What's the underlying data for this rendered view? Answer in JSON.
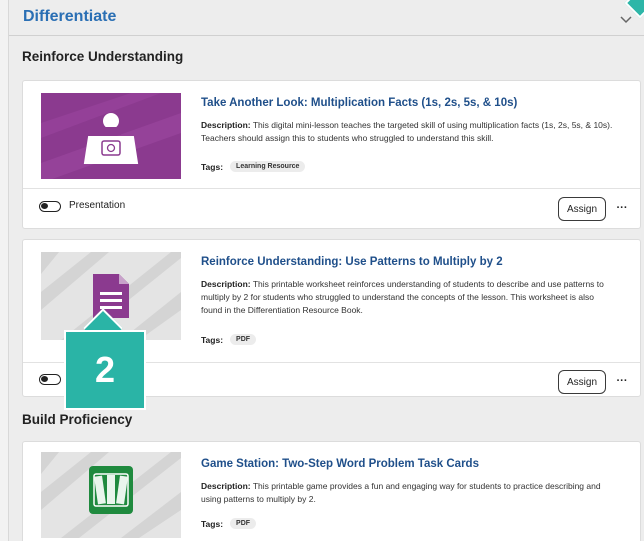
{
  "header": {
    "title": "Differentiate"
  },
  "sections": {
    "reinforce": {
      "title": "Reinforce Understanding"
    },
    "proficiency": {
      "title": "Build Proficiency"
    }
  },
  "cards": [
    {
      "title": "Take Another Look: Multiplication Facts (1s, 2s, 5s, & 10s)",
      "desc_label": "Description:",
      "description": "This digital mini-lesson teaches the targeted skill of using multiplication facts (1s, 2s, 5s, & 10s). Teachers should assign this to students who struggled to understand this skill.",
      "tags_label": "Tags:",
      "tag": "Learning Resource",
      "toggle_label": "Presentation",
      "assign_label": "Assign",
      "more_label": "···",
      "thumb_icon": "presentation-screen-icon",
      "thumb_color": "#8b3a8f"
    },
    {
      "title": "Reinforce Understanding: Use Patterns to Multiply by 2",
      "desc_label": "Description:",
      "description": "This printable worksheet reinforces understanding of students to describe and use patterns to multiply by 2 for students who struggled to understand the concepts of the lesson. This worksheet is also found in the Differentiation Resource Book.",
      "tags_label": "Tags:",
      "tag": "PDF",
      "toggle_label": "P",
      "assign_label": "Assign",
      "more_label": "···",
      "thumb_icon": "document-icon",
      "thumb_color": "#8b3a8f"
    },
    {
      "title": "Game Station: Two-Step Word Problem Task Cards",
      "desc_label": "Description:",
      "description": "This printable game provides a fun and engaging way for students to practice describing and using patterns to multiply by 2.",
      "tags_label": "Tags:",
      "tag": "PDF",
      "thumb_icon": "cards-icon",
      "thumb_color": "#1f8a3e"
    }
  ],
  "callout": {
    "number": "2"
  },
  "colors": {
    "accent": "#2a6fb4",
    "callout": "#2ab4a6",
    "purple": "#8b3a8f",
    "green": "#1f8a3e"
  }
}
